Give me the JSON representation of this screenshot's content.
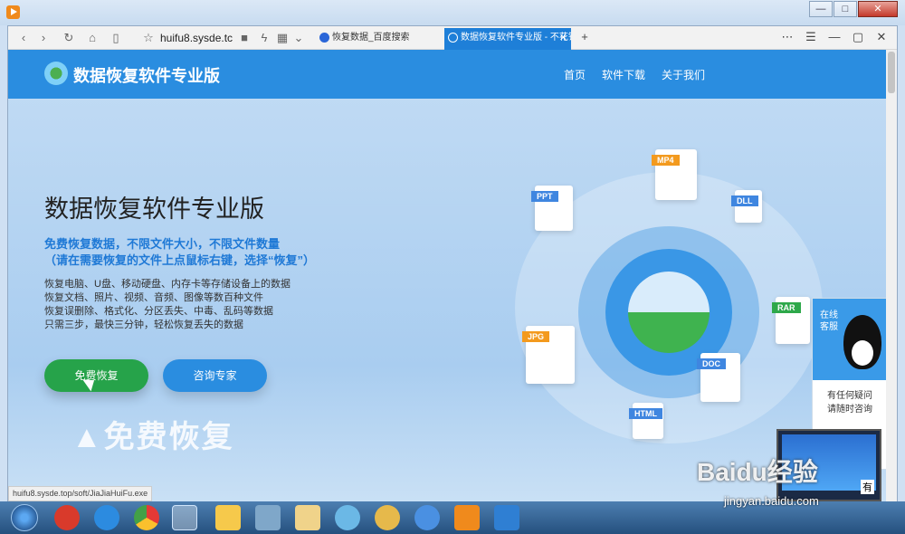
{
  "window": {
    "controls": [
      "—",
      "□",
      "✕"
    ]
  },
  "browser": {
    "url": "huifu8.sysde.tc",
    "tabs": [
      {
        "label": "恢复数据_百度搜索",
        "active": false
      },
      {
        "label": "数据恢复软件专业版 - 不花钱",
        "active": true
      }
    ],
    "new_tab": "+",
    "toolbar_right": [
      "⋯",
      "☰",
      "—",
      "▢",
      "✕"
    ]
  },
  "site": {
    "logo_text": "数据恢复软件专业版",
    "nav": [
      "首页",
      "软件下载",
      "关于我们"
    ]
  },
  "hero": {
    "title": "数据恢复软件专业版",
    "subtitle_1": "免费恢复数据，不限文件大小，不限文件数量",
    "subtitle_2": "（请在需要恢复的文件上点鼠标右键，选择“恢复”）",
    "desc": [
      "恢复电脑、U盘、移动硬盘、内存卡等存储设备上的数据",
      "恢复文档、照片、视频、音频、图像等数百种文件",
      "恢复误删除、格式化、分区丢失、中毒、乱码等数据",
      "只需三步，最快三分钟，轻松恢复丢失的数据"
    ],
    "btn_free": "免费恢复",
    "btn_ask": "咨询专家",
    "big_label": "▲免费恢复"
  },
  "file_types": [
    "MP4",
    "PPT",
    "DLL",
    "RAR",
    "JPG",
    "DOC",
    "HTML"
  ],
  "service": {
    "online": "在线\n客服",
    "line1": "有任何疑问",
    "line2": "请随时咨询"
  },
  "status_url": "huifu8.sysde.top/soft/JiaJiaHuiFu.exe",
  "watermark": {
    "text": "Baidu经验",
    "sub": "jingyan.baidu.com",
    "screen_text": "有"
  },
  "colors": {
    "accent": "#2a8de0",
    "green": "#26a34a",
    "title_blue": "#1f79d6"
  }
}
